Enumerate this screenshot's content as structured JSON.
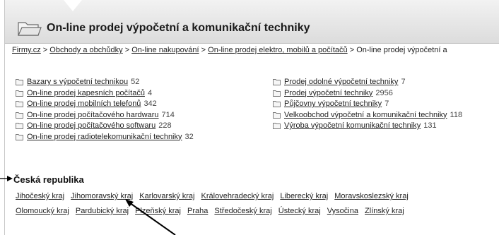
{
  "header": {
    "title": "On-line prodej výpočetní a komunikační techniky",
    "icon": "folder-icon"
  },
  "breadcrumb": {
    "items": [
      {
        "label": "Firmy.cz",
        "link": true
      },
      {
        "label": "Obchody a obchůdky",
        "link": true
      },
      {
        "label": "On-line nakupování",
        "link": true
      },
      {
        "label": "On-line prodej elektro, mobilů a počítačů",
        "link": true
      },
      {
        "label": "On-line prodej výpočetní a",
        "link": false
      }
    ],
    "separator": ">"
  },
  "categories_left": [
    {
      "label": "Bazary s výpočetní technikou",
      "count": "52"
    },
    {
      "label": "On-line prodej kapesních počítačů",
      "count": "4"
    },
    {
      "label": "On-line prodej mobilních telefonů",
      "count": "342"
    },
    {
      "label": "On-line prodej počítačového hardwaru",
      "count": "714"
    },
    {
      "label": "On-line prodej počítačového softwaru",
      "count": "228"
    },
    {
      "label": "On-line prodej radiotelekomunikační techniky",
      "count": "32"
    }
  ],
  "categories_right": [
    {
      "label": "Prodej odolné výpočetní techniky",
      "count": "7"
    },
    {
      "label": "Prodej výpočetní techniky",
      "count": "2956"
    },
    {
      "label": "Půjčovny výpočetní techniky",
      "count": "7"
    },
    {
      "label": "Velkoobchod výpočetní a komunikační techniky",
      "count": "118"
    },
    {
      "label": "Výroba výpočetní komunikační techniky",
      "count": "131"
    }
  ],
  "regions": {
    "title": "Česká republika",
    "items": [
      "Jihočeský kraj",
      "Jihomoravský kraj",
      "Karlovarský kraj",
      "Královehradecký kraj",
      "Liberecký kraj",
      "Moravskoslezský kraj",
      "Olomoucký kraj",
      "Pardubický kraj",
      "Plzeňský kraj",
      "Praha",
      "Středočeský kraj",
      "Ústecký kraj",
      "Vysočina",
      "Zlínský kraj"
    ]
  },
  "colors": {
    "header_bg": "#dcdcdc",
    "link": "#222222",
    "arrow": "#000000"
  }
}
